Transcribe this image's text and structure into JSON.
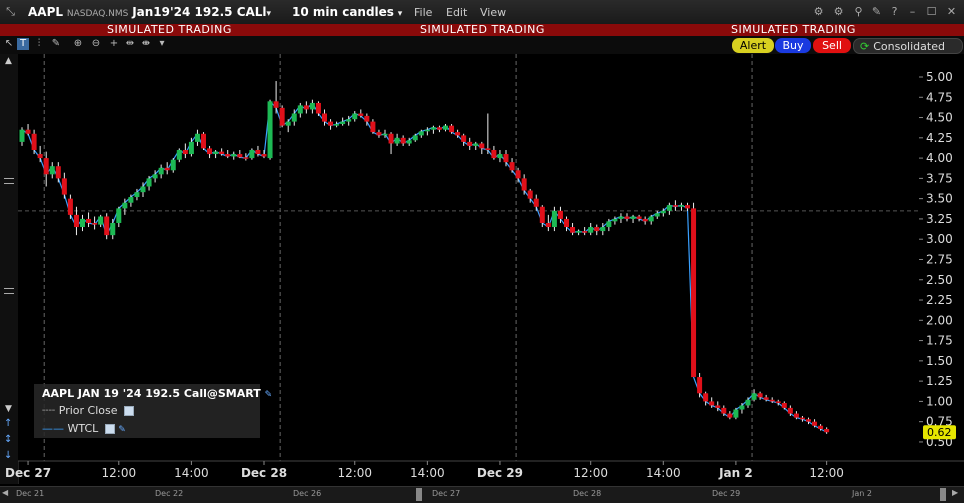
{
  "window": {
    "symbol": "AAPL",
    "exchange": "NASDAQ.NMS",
    "contract": "Jan19'24 192.5 CALl",
    "interval": "10 min candles",
    "menu": [
      "File",
      "Edit",
      "View"
    ]
  },
  "banner": {
    "text": "SIMULATED TRADING"
  },
  "actions": {
    "alert": "Alert",
    "buy": "Buy",
    "sell": "Sell",
    "consolidated": "Consolidated"
  },
  "legend": {
    "title": "AAPL JAN 19 '24 192.5 Call@SMART",
    "items": [
      {
        "label": "Prior Close"
      },
      {
        "label": "WTCL"
      }
    ]
  },
  "navigator": {
    "labels": [
      "Dec 21",
      "Dec 22",
      "Dec 26",
      "Dec 27",
      "Dec 28",
      "Dec 29",
      "Jan 2"
    ]
  },
  "colors": {
    "up": "#1db954",
    "down": "#e0101a",
    "line": "#3aa0ff",
    "price_tag": "#e6e600"
  },
  "chart_data": {
    "type": "candlestick",
    "title": "",
    "xlabel": "",
    "ylabel": "",
    "ylim": [
      0.5,
      5.0
    ],
    "y_ticks": [
      5.0,
      4.75,
      4.5,
      4.25,
      4.0,
      3.75,
      3.5,
      3.25,
      3.0,
      2.75,
      2.5,
      2.25,
      2.0,
      1.75,
      1.5,
      1.25,
      1.0,
      0.75,
      0.5
    ],
    "x_ticks": [
      {
        "label": "Dec 27",
        "bold": true,
        "index": 1
      },
      {
        "label": "12:00",
        "index": 16
      },
      {
        "label": "14:00",
        "index": 28
      },
      {
        "label": "Dec 28",
        "bold": true,
        "index": 40
      },
      {
        "label": "12:00",
        "index": 55
      },
      {
        "label": "14:00",
        "index": 67
      },
      {
        "label": "Dec 29",
        "bold": true,
        "index": 79
      },
      {
        "label": "12:00",
        "index": 94
      },
      {
        "label": "14:00",
        "index": 106
      },
      {
        "label": "Jan 2",
        "bold": true,
        "index": 118
      },
      {
        "label": "12:00",
        "index": 133
      }
    ],
    "session_boundaries": [
      4,
      43,
      82,
      121
    ],
    "prior_close": 3.35,
    "last_price": "0.62",
    "candles": [
      [
        4.2,
        4.38,
        4.15,
        4.35
      ],
      [
        4.35,
        4.42,
        4.28,
        4.3
      ],
      [
        4.3,
        4.35,
        4.05,
        4.1
      ],
      [
        4.05,
        4.15,
        3.95,
        4.0
      ],
      [
        4.0,
        4.08,
        3.65,
        3.8
      ],
      [
        3.8,
        3.95,
        3.75,
        3.9
      ],
      [
        3.9,
        3.95,
        3.7,
        3.75
      ],
      [
        3.75,
        3.82,
        3.5,
        3.55
      ],
      [
        3.5,
        3.55,
        3.25,
        3.3
      ],
      [
        3.3,
        3.4,
        3.05,
        3.15
      ],
      [
        3.15,
        3.3,
        3.1,
        3.25
      ],
      [
        3.25,
        3.33,
        3.15,
        3.2
      ],
      [
        3.2,
        3.28,
        3.12,
        3.18
      ],
      [
        3.18,
        3.3,
        3.15,
        3.28
      ],
      [
        3.28,
        3.32,
        3.0,
        3.05
      ],
      [
        3.05,
        3.25,
        3.0,
        3.2
      ],
      [
        3.2,
        3.4,
        3.15,
        3.38
      ],
      [
        3.38,
        3.5,
        3.3,
        3.45
      ],
      [
        3.45,
        3.55,
        3.4,
        3.52
      ],
      [
        3.52,
        3.62,
        3.48,
        3.58
      ],
      [
        3.58,
        3.7,
        3.52,
        3.65
      ],
      [
        3.65,
        3.78,
        3.6,
        3.75
      ],
      [
        3.75,
        3.85,
        3.7,
        3.8
      ],
      [
        3.8,
        3.92,
        3.75,
        3.88
      ],
      [
        3.88,
        3.95,
        3.8,
        3.85
      ],
      [
        3.85,
        4.0,
        3.82,
        3.98
      ],
      [
        3.98,
        4.12,
        3.95,
        4.1
      ],
      [
        4.1,
        4.18,
        4.0,
        4.05
      ],
      [
        4.05,
        4.25,
        4.02,
        4.2
      ],
      [
        4.2,
        4.35,
        4.15,
        4.3
      ],
      [
        4.3,
        4.32,
        4.1,
        4.12
      ],
      [
        4.12,
        4.15,
        4.0,
        4.05
      ],
      [
        4.05,
        4.1,
        4.0,
        4.08
      ],
      [
        4.08,
        4.12,
        4.03,
        4.05
      ],
      [
        4.05,
        4.1,
        4.0,
        4.02
      ],
      [
        4.02,
        4.08,
        3.98,
        4.05
      ],
      [
        4.05,
        4.1,
        4.0,
        4.01
      ],
      [
        4.01,
        4.06,
        3.97,
        4.0
      ],
      [
        4.0,
        4.12,
        3.98,
        4.1
      ],
      [
        4.1,
        4.15,
        4.02,
        4.05
      ],
      [
        4.05,
        4.1,
        4.0,
        4.02
      ],
      [
        4.0,
        4.72,
        3.98,
        4.7
      ],
      [
        4.7,
        4.95,
        4.55,
        4.62
      ],
      [
        4.62,
        4.65,
        4.38,
        4.4
      ],
      [
        4.4,
        4.48,
        4.32,
        4.45
      ],
      [
        4.45,
        4.6,
        4.4,
        4.55
      ],
      [
        4.55,
        4.68,
        4.5,
        4.65
      ],
      [
        4.65,
        4.7,
        4.55,
        4.6
      ],
      [
        4.6,
        4.72,
        4.55,
        4.68
      ],
      [
        4.68,
        4.7,
        4.52,
        4.55
      ],
      [
        4.55,
        4.6,
        4.4,
        4.45
      ],
      [
        4.45,
        4.48,
        4.35,
        4.4
      ],
      [
        4.4,
        4.45,
        4.38,
        4.42
      ],
      [
        4.42,
        4.5,
        4.4,
        4.45
      ],
      [
        4.45,
        4.52,
        4.4,
        4.48
      ],
      [
        4.48,
        4.58,
        4.45,
        4.55
      ],
      [
        4.55,
        4.6,
        4.5,
        4.52
      ],
      [
        4.52,
        4.55,
        4.4,
        4.45
      ],
      [
        4.45,
        4.48,
        4.3,
        4.32
      ],
      [
        4.32,
        4.35,
        4.25,
        4.28
      ],
      [
        4.28,
        4.35,
        4.25,
        4.3
      ],
      [
        4.3,
        4.32,
        4.05,
        4.18
      ],
      [
        4.18,
        4.3,
        4.15,
        4.25
      ],
      [
        4.25,
        4.28,
        4.15,
        4.18
      ],
      [
        4.18,
        4.25,
        4.15,
        4.22
      ],
      [
        4.22,
        4.3,
        4.2,
        4.28
      ],
      [
        4.28,
        4.35,
        4.25,
        4.33
      ],
      [
        4.33,
        4.38,
        4.28,
        4.35
      ],
      [
        4.35,
        4.4,
        4.3,
        4.38
      ],
      [
        4.38,
        4.4,
        4.32,
        4.35
      ],
      [
        4.35,
        4.42,
        4.33,
        4.4
      ],
      [
        4.4,
        4.42,
        4.3,
        4.32
      ],
      [
        4.32,
        4.35,
        4.25,
        4.28
      ],
      [
        4.28,
        4.3,
        4.15,
        4.2
      ],
      [
        4.2,
        4.25,
        4.1,
        4.15
      ],
      [
        4.15,
        4.2,
        4.1,
        4.18
      ],
      [
        4.18,
        4.2,
        4.05,
        4.12
      ],
      [
        4.12,
        4.55,
        4.05,
        4.1
      ],
      [
        4.1,
        4.15,
        3.98,
        4.0
      ],
      [
        4.0,
        4.1,
        3.95,
        4.05
      ],
      [
        4.05,
        4.1,
        3.9,
        3.95
      ],
      [
        3.95,
        4.0,
        3.82,
        3.85
      ],
      [
        3.85,
        3.88,
        3.7,
        3.75
      ],
      [
        3.75,
        3.8,
        3.55,
        3.6
      ],
      [
        3.6,
        3.62,
        3.45,
        3.5
      ],
      [
        3.5,
        3.55,
        3.35,
        3.4
      ],
      [
        3.4,
        3.42,
        3.15,
        3.2
      ],
      [
        3.2,
        3.3,
        3.1,
        3.15
      ],
      [
        3.15,
        3.4,
        3.1,
        3.35
      ],
      [
        3.35,
        3.4,
        3.2,
        3.25
      ],
      [
        3.25,
        3.28,
        3.1,
        3.15
      ],
      [
        3.15,
        3.2,
        3.05,
        3.08
      ],
      [
        3.08,
        3.12,
        3.05,
        3.1
      ],
      [
        3.1,
        3.15,
        3.05,
        3.08
      ],
      [
        3.08,
        3.2,
        3.05,
        3.15
      ],
      [
        3.15,
        3.18,
        3.05,
        3.1
      ],
      [
        3.1,
        3.2,
        3.05,
        3.15
      ],
      [
        3.15,
        3.25,
        3.1,
        3.22
      ],
      [
        3.22,
        3.28,
        3.18,
        3.25
      ],
      [
        3.25,
        3.32,
        3.2,
        3.28
      ],
      [
        3.28,
        3.32,
        3.22,
        3.25
      ],
      [
        3.25,
        3.3,
        3.2,
        3.28
      ],
      [
        3.28,
        3.3,
        3.22,
        3.25
      ],
      [
        3.25,
        3.28,
        3.18,
        3.22
      ],
      [
        3.22,
        3.3,
        3.18,
        3.28
      ],
      [
        3.28,
        3.35,
        3.25,
        3.32
      ],
      [
        3.32,
        3.38,
        3.28,
        3.35
      ],
      [
        3.35,
        3.45,
        3.3,
        3.42
      ],
      [
        3.42,
        3.48,
        3.35,
        3.4
      ],
      [
        3.4,
        3.45,
        3.35,
        3.42
      ],
      [
        3.42,
        3.45,
        3.35,
        3.38
      ],
      [
        3.38,
        3.45,
        1.55,
        1.3
      ],
      [
        1.3,
        1.35,
        1.05,
        1.1
      ],
      [
        1.1,
        1.12,
        0.95,
        1.0
      ],
      [
        1.0,
        1.05,
        0.92,
        0.95
      ],
      [
        0.95,
        1.0,
        0.88,
        0.92
      ],
      [
        0.92,
        0.95,
        0.82,
        0.85
      ],
      [
        0.85,
        0.88,
        0.78,
        0.8
      ],
      [
        0.8,
        0.92,
        0.78,
        0.9
      ],
      [
        0.9,
        0.98,
        0.85,
        0.95
      ],
      [
        0.95,
        1.05,
        0.92,
        1.02
      ],
      [
        1.02,
        1.15,
        1.0,
        1.1
      ],
      [
        1.1,
        1.12,
        1.02,
        1.05
      ],
      [
        1.05,
        1.08,
        1.0,
        1.02
      ],
      [
        1.02,
        1.05,
        0.98,
        1.0
      ],
      [
        1.0,
        1.02,
        0.95,
        0.98
      ],
      [
        0.98,
        1.0,
        0.9,
        0.92
      ],
      [
        0.92,
        0.95,
        0.82,
        0.85
      ],
      [
        0.85,
        0.88,
        0.78,
        0.8
      ],
      [
        0.8,
        0.82,
        0.75,
        0.78
      ],
      [
        0.78,
        0.8,
        0.72,
        0.75
      ],
      [
        0.75,
        0.78,
        0.68,
        0.7
      ],
      [
        0.7,
        0.72,
        0.64,
        0.66
      ],
      [
        0.66,
        0.68,
        0.6,
        0.62
      ]
    ]
  }
}
